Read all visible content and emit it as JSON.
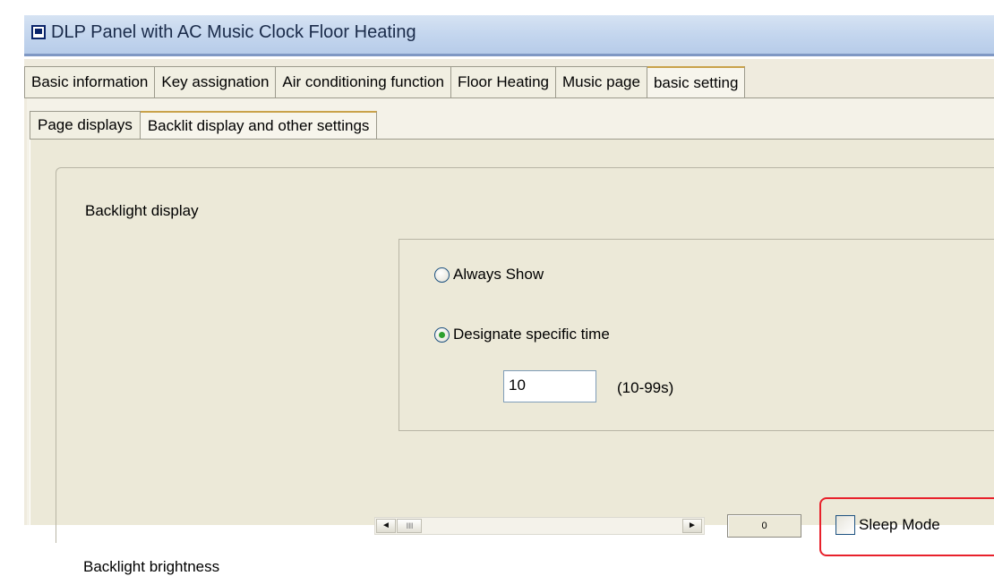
{
  "window": {
    "title": "DLP Panel with AC Music Clock Floor Heating"
  },
  "main_tabs": [
    {
      "label": "Basic information"
    },
    {
      "label": "Key assignation"
    },
    {
      "label": "Air conditioning function"
    },
    {
      "label": "Floor Heating"
    },
    {
      "label": "Music page"
    },
    {
      "label": "basic setting"
    }
  ],
  "main_tabs_active": "basic setting",
  "sub_tabs": [
    {
      "label": "Page displays"
    },
    {
      "label": "Backlit display and other settings"
    }
  ],
  "sub_tabs_active": "Backlit display and other settings",
  "backlight_display": {
    "label": "Backlight display",
    "options": [
      {
        "label": "Always Show",
        "checked": false
      },
      {
        "label": "Designate specific time",
        "checked": true
      }
    ],
    "time_value": "10",
    "time_range": "(10-99s)"
  },
  "backlight_brightness": {
    "label": "Backlight brightness",
    "value": "0",
    "scroll_left_glyph": "◄",
    "scroll_right_glyph": "►",
    "thumb_glyph": "IIIII"
  },
  "sleep_mode": {
    "label": "Sleep Mode",
    "checked": false
  },
  "colors": {
    "highlight": "#e8212b",
    "titlebar": "#c4d6ee"
  }
}
